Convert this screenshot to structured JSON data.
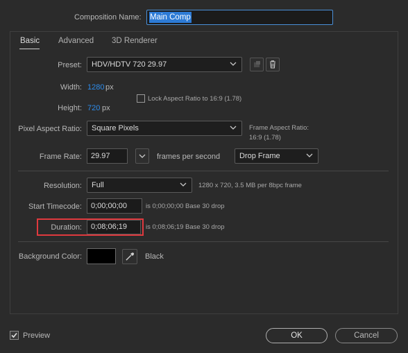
{
  "comp_name": {
    "label": "Composition Name:",
    "value": "Main Comp"
  },
  "tabs": [
    {
      "label": "Basic",
      "active": true
    },
    {
      "label": "Advanced",
      "active": false
    },
    {
      "label": "3D Renderer",
      "active": false
    }
  ],
  "preset": {
    "label": "Preset:",
    "value": "HDV/HDTV 720 29.97",
    "save_icon": "save-preset-icon",
    "delete_icon": "trash-icon"
  },
  "width": {
    "label": "Width:",
    "value": "1280",
    "unit": "px"
  },
  "height": {
    "label": "Height:",
    "value": "720",
    "unit": "px"
  },
  "lock_aspect": {
    "label": "Lock Aspect Ratio to 16:9 (1.78)",
    "checked": false
  },
  "pixel_aspect": {
    "label": "Pixel Aspect Ratio:",
    "value": "Square Pixels",
    "frame_aspect_label": "Frame Aspect Ratio:",
    "frame_aspect_value": "16:9 (1.78)"
  },
  "frame_rate": {
    "label": "Frame Rate:",
    "value": "29.97",
    "unit": "frames per second",
    "mode": "Drop Frame"
  },
  "resolution": {
    "label": "Resolution:",
    "value": "Full",
    "info": "1280 x 720, 3.5 MB per 8bpc frame"
  },
  "start_timecode": {
    "label": "Start Timecode:",
    "value": "0;00;00;00",
    "info": "is 0;00;00;00  Base 30  drop"
  },
  "duration": {
    "label": "Duration:",
    "value": "0;08;06;19",
    "info": "is 0;08;06;19  Base 30  drop",
    "highlight_color": "#e0393e"
  },
  "background_color": {
    "label": "Background Color:",
    "swatch": "#000000",
    "name": "Black",
    "eyedropper_icon": "eyedropper-icon"
  },
  "preview": {
    "label": "Preview",
    "checked": true
  },
  "buttons": {
    "ok": "OK",
    "cancel": "Cancel"
  },
  "colors": {
    "accent": "#2d8ceb",
    "background": "#2b2b2b"
  }
}
